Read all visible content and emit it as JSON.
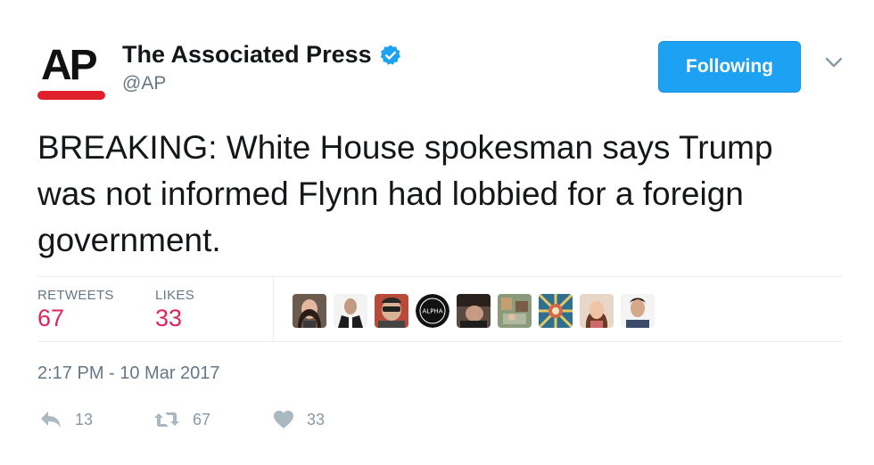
{
  "account": {
    "avatar_text": "AP",
    "display_name": "The Associated Press",
    "handle": "@AP",
    "verified": true,
    "verified_color": "#1da1f2",
    "brand_red": "#e0202c"
  },
  "follow_button": {
    "label": "Following",
    "color": "#1da1f2"
  },
  "tweet": {
    "text": "BREAKING: White House spokesman says Trump was not informed Flynn had lobbied for a foreign government."
  },
  "stats": {
    "retweets_label": "RETWEETS",
    "retweets_count": "67",
    "likes_label": "LIKES",
    "likes_count": "33",
    "count_color": "#e0245e"
  },
  "liker_avatars": [
    {
      "name": "liker-1"
    },
    {
      "name": "liker-2"
    },
    {
      "name": "liker-3"
    },
    {
      "name": "liker-4",
      "text": "ALPHA"
    },
    {
      "name": "liker-5"
    },
    {
      "name": "liker-6"
    },
    {
      "name": "liker-7"
    },
    {
      "name": "liker-8"
    },
    {
      "name": "liker-9"
    }
  ],
  "timestamp": "2:17 PM - 10 Mar 2017",
  "actions": {
    "reply_icon": "reply-icon",
    "reply_count": "13",
    "retweet_icon": "retweet-icon",
    "retweet_count": "67",
    "like_icon": "heart-icon",
    "like_count": "33",
    "icon_color": "#aab8c2"
  }
}
